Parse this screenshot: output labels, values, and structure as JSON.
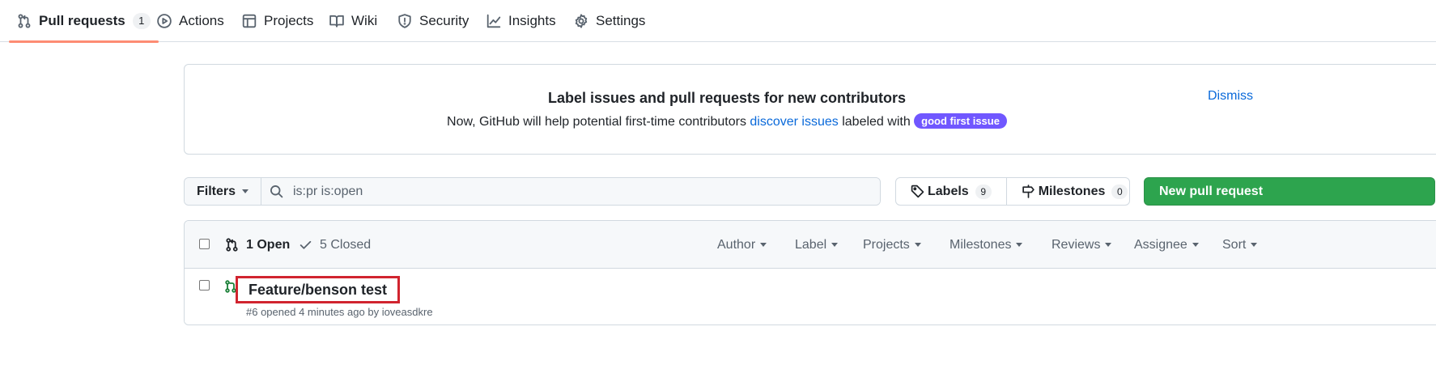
{
  "nav": {
    "tabs": [
      {
        "label": "Pull requests",
        "count": "1",
        "icon": "git-pull-request-icon",
        "selected": true
      },
      {
        "label": "Actions",
        "icon": "play-icon"
      },
      {
        "label": "Projects",
        "icon": "table-icon"
      },
      {
        "label": "Wiki",
        "icon": "book-icon"
      },
      {
        "label": "Security",
        "icon": "shield-icon"
      },
      {
        "label": "Insights",
        "icon": "graph-icon"
      },
      {
        "label": "Settings",
        "icon": "gear-icon"
      }
    ]
  },
  "banner": {
    "title": "Label issues and pull requests for new contributors",
    "text_before": "Now, GitHub will help potential first-time contributors ",
    "link": "discover issues",
    "text_after": " labeled with ",
    "label": "good first issue",
    "label_color": "#7057ff",
    "dismiss": "Dismiss"
  },
  "filters": {
    "button_label": "Filters",
    "search_value": "is:pr is:open"
  },
  "labels": {
    "label": "Labels",
    "count": "9"
  },
  "milestones": {
    "label": "Milestones",
    "count": "0"
  },
  "new_pr": {
    "label": "New pull request",
    "color": "#2da44e"
  },
  "list": {
    "open_label": "1 Open",
    "closed_label": "5 Closed",
    "sort_filters": [
      "Author",
      "Label",
      "Projects",
      "Milestones",
      "Reviews",
      "Assignee",
      "Sort"
    ],
    "rows": [
      {
        "title": "Feature/benson test",
        "number_opened": "#6 opened 4 minutes ago by ",
        "author": "ioveasdkre"
      }
    ]
  },
  "colors": {
    "accent_link": "#0969da",
    "selected_tab_underline": "#fd8c73",
    "open_pr_icon": "#1a7f37",
    "highlight_box": "#d1242f"
  }
}
